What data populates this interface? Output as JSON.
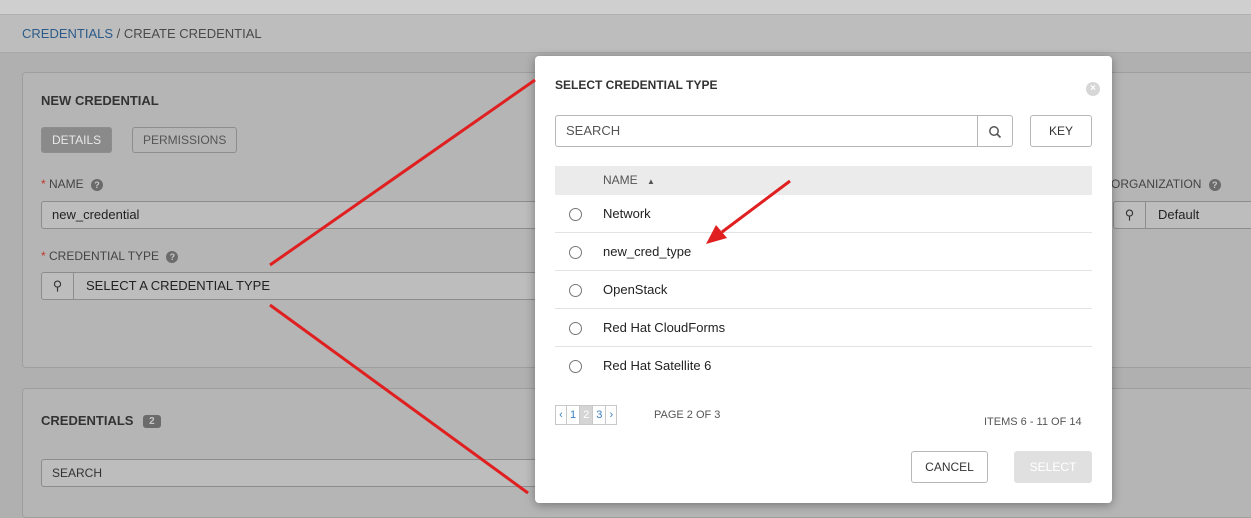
{
  "breadcrumb": {
    "parent": "CREDENTIALS",
    "separator": "/",
    "current": "CREATE CREDENTIAL"
  },
  "form": {
    "title": "NEW CREDENTIAL",
    "tabs": [
      {
        "label": "DETAILS",
        "active": true
      },
      {
        "label": "PERMISSIONS",
        "active": false
      }
    ],
    "name_label": "NAME",
    "name_value": "new_credential",
    "credential_type_label": "CREDENTIAL TYPE",
    "credential_type_placeholder": "SELECT A CREDENTIAL TYPE",
    "organization_label": "ORGANIZATION",
    "organization_value": "Default",
    "required_marker": "*"
  },
  "credentials_list": {
    "title": "CREDENTIALS",
    "count": "2",
    "search_placeholder": "SEARCH"
  },
  "modal": {
    "title": "SELECT CREDENTIAL TYPE",
    "search_placeholder": "SEARCH",
    "key_label": "KEY",
    "column_header": "NAME",
    "sort_indicator": "▲",
    "rows": [
      {
        "name": "Network"
      },
      {
        "name": "new_cred_type"
      },
      {
        "name": "OpenStack"
      },
      {
        "name": "Red Hat CloudForms"
      },
      {
        "name": "Red Hat Satellite 6"
      }
    ],
    "pagination": {
      "prev": "‹",
      "pages": [
        "1",
        "2",
        "3"
      ],
      "current": "2",
      "next": "›",
      "page_of": "PAGE 2 OF 3"
    },
    "items_count": "ITEMS 6 - 11 OF 14",
    "cancel_label": "CANCEL",
    "select_label": "SELECT"
  },
  "icons": {
    "search": "search-icon",
    "help": "help-icon",
    "close": "close-icon"
  },
  "colors": {
    "annotation_arrow": "#e02020",
    "link": "#2c5b8a",
    "required": "#c0392b"
  }
}
